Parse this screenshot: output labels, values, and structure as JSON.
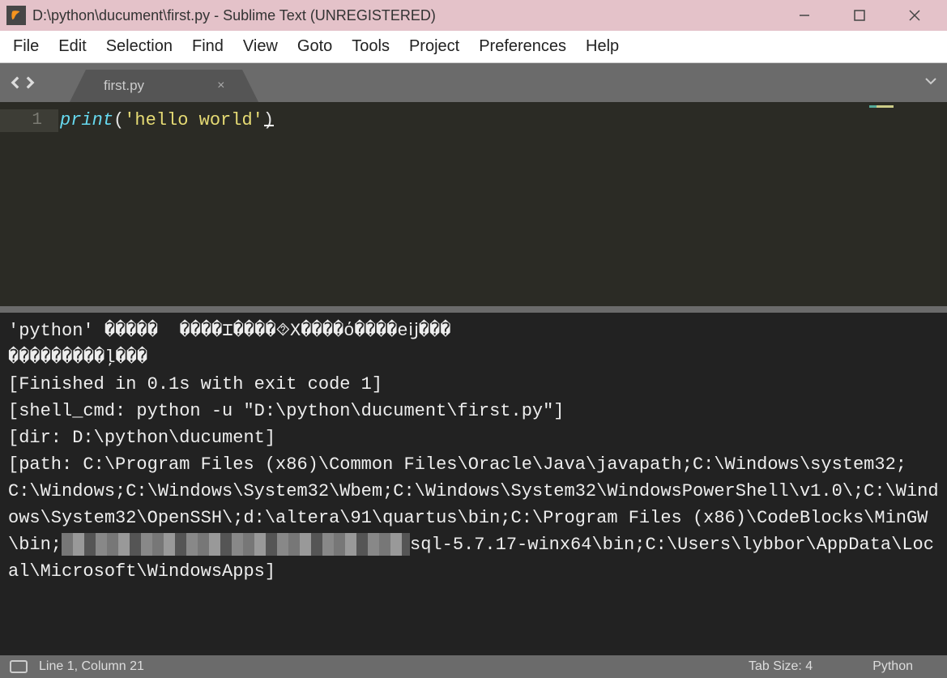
{
  "titlebar": {
    "title": "D:\\python\\ducument\\first.py - Sublime Text (UNREGISTERED)"
  },
  "menu": {
    "items": [
      "File",
      "Edit",
      "Selection",
      "Find",
      "View",
      "Goto",
      "Tools",
      "Project",
      "Preferences",
      "Help"
    ]
  },
  "tab": {
    "label": "first.py",
    "close": "×"
  },
  "editor": {
    "line_numbers": [
      "1"
    ],
    "tokens": {
      "fn": "print",
      "open": "(",
      "str": "'hello world'",
      "close": ")"
    }
  },
  "console": {
    "line1": "'python' �����  ����⌶����⯑X����ό����eĳ���",
    "line2": "���������ļ���",
    "line3": "[Finished in 0.1s with exit code 1]",
    "line4": "[shell_cmd: python -u \"D:\\python\\ducument\\first.py\"]",
    "line5": "[dir: D:\\python\\ducument]",
    "path_a": "[path: C:\\Program Files (x86)\\Common Files\\Oracle\\Java\\javapath;C:\\Windows\\system32;C:\\Windows;C:\\Windows\\System32\\Wbem;C:\\Windows\\System32\\WindowsPowerShell\\v1.0\\;C:\\Windows\\System32\\OpenSSH\\;d:\\altera\\91\\quartus\\bin;C:\\Program Files (x86)\\CodeBlocks\\MinGW\\bin;",
    "path_b": "sql-5.7.17-winx64\\bin;C:\\Users\\lybbor\\AppData\\Local\\Microsoft\\WindowsApps]"
  },
  "status": {
    "line_col": "Line 1, Column 21",
    "tab_size": "Tab Size: 4",
    "syntax": "Python"
  }
}
